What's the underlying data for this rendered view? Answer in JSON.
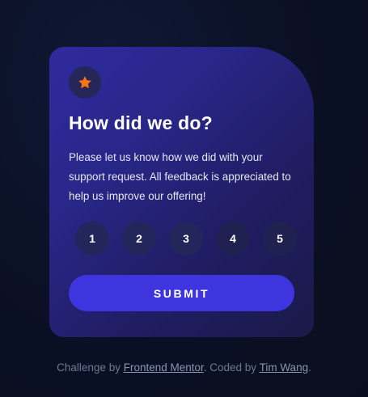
{
  "card": {
    "icon": "star-icon",
    "title": "How did we do?",
    "description": "Please let us know how we did with your support request. All feedback is appreciated to help us improve our offering!",
    "ratings": [
      "1",
      "2",
      "3",
      "4",
      "5"
    ],
    "submit_label": "SUBMIT"
  },
  "attribution": {
    "prefix": "Challenge by ",
    "challenge_link": "Frontend Mentor",
    "middle": ". Coded by ",
    "author_link": "Tim Wang",
    "suffix": "."
  },
  "colors": {
    "background": "#0b1126",
    "card": "#29278a",
    "star": "#fb7413",
    "submit": "#3f35de",
    "rating_circle": "#23265a"
  }
}
